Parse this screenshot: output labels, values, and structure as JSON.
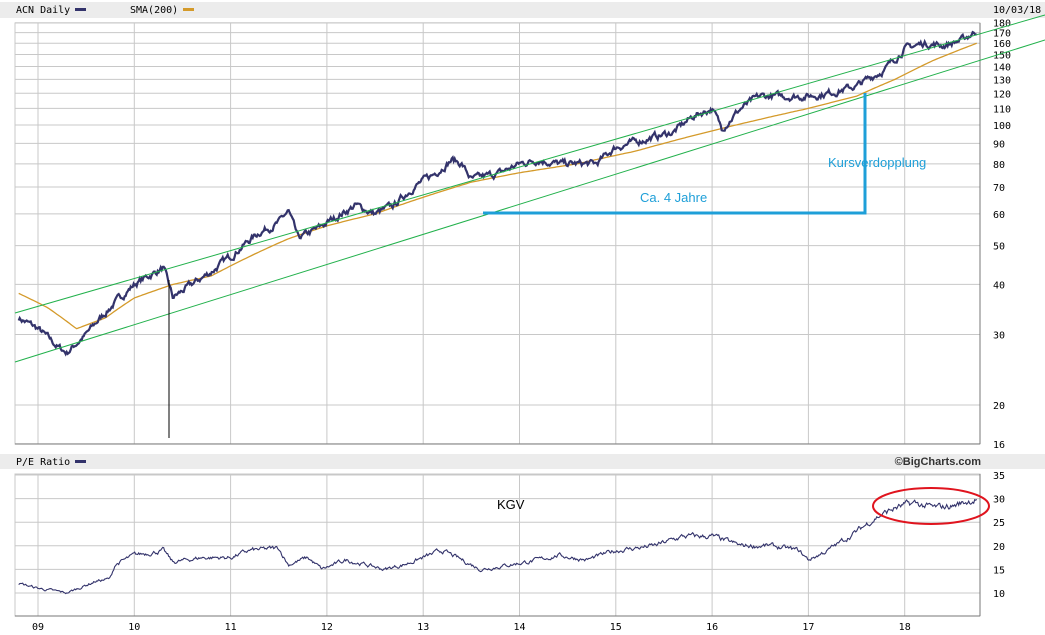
{
  "colors": {
    "price": "#33336b",
    "sma": "#d49a2a",
    "channel": "#22b14c",
    "annotation": "#1e9fd8",
    "highlight": "#e0141e",
    "grid": "#c8c8c8"
  },
  "chart_data": [
    {
      "type": "line",
      "title": "ACN Daily",
      "legend": [
        "ACN Daily",
        "SMA(200)"
      ],
      "date_label": "10/03/18",
      "yscale": "log",
      "ylim": [
        16,
        180
      ],
      "yticks": [
        180,
        170,
        160,
        150,
        140,
        130,
        120,
        110,
        100,
        90,
        80,
        70,
        60,
        50,
        40,
        30,
        20,
        16
      ],
      "xticks": [
        "09",
        "10",
        "11",
        "12",
        "13",
        "14",
        "15",
        "16",
        "17",
        "18"
      ],
      "series": [
        {
          "name": "ACN Daily",
          "x": [
            2008.8,
            2009.0,
            2009.2,
            2009.3,
            2009.5,
            2009.75,
            2010.0,
            2010.3,
            2010.4,
            2010.6,
            2010.8,
            2011.0,
            2011.3,
            2011.5,
            2011.6,
            2011.7,
            2011.9,
            2012.0,
            2012.3,
            2012.5,
            2012.7,
            2012.9,
            2013.1,
            2013.3,
            2013.4,
            2013.5,
            2013.8,
            2014.0,
            2014.2,
            2014.4,
            2014.6,
            2014.8,
            2015.0,
            2015.3,
            2015.6,
            2015.8,
            2016.0,
            2016.1,
            2016.3,
            2016.5,
            2016.8,
            2017.0,
            2017.2,
            2017.5,
            2017.8,
            2018.0,
            2018.2,
            2018.4,
            2018.6,
            2018.75
          ],
          "values": [
            33,
            31,
            28,
            27,
            30,
            35,
            40,
            44,
            37,
            40,
            43,
            47,
            54,
            57,
            61,
            52,
            55,
            57,
            63,
            60,
            63,
            70,
            75,
            82,
            80,
            73,
            76,
            80,
            82,
            80,
            80,
            80,
            88,
            92,
            96,
            105,
            110,
            98,
            110,
            118,
            118,
            118,
            120,
            125,
            138,
            155,
            160,
            158,
            163,
            172
          ]
        },
        {
          "name": "SMA(200)",
          "x": [
            2008.8,
            2009.1,
            2009.4,
            2009.7,
            2010.0,
            2010.4,
            2010.8,
            2011.2,
            2011.6,
            2012.0,
            2012.5,
            2013.0,
            2013.5,
            2014.0,
            2014.6,
            2015.2,
            2015.8,
            2016.4,
            2017.0,
            2017.5,
            2017.9,
            2018.3,
            2018.75
          ],
          "values": [
            38,
            35,
            31,
            33,
            37,
            40,
            42,
            47,
            52,
            56,
            60,
            66,
            72,
            76,
            80,
            86,
            94,
            102,
            110,
            118,
            130,
            145,
            160
          ]
        }
      ],
      "annotations": [
        "Kursverdopplung",
        "Ca. 4 Jahre"
      ]
    },
    {
      "type": "line",
      "title": "P/E Ratio",
      "ylim": [
        5,
        35
      ],
      "yticks": [
        35,
        30,
        25,
        20,
        15,
        10
      ],
      "xticks": [
        "09",
        "10",
        "11",
        "12",
        "13",
        "14",
        "15",
        "16",
        "17",
        "18"
      ],
      "series": [
        {
          "name": "P/E Ratio",
          "x": [
            2008.8,
            2009.0,
            2009.3,
            2009.6,
            2009.75,
            2009.8,
            2010.0,
            2010.3,
            2010.4,
            2010.7,
            2011.0,
            2011.2,
            2011.5,
            2011.6,
            2011.8,
            2011.95,
            2012.2,
            2012.4,
            2012.6,
            2012.8,
            2013.0,
            2013.2,
            2013.4,
            2013.6,
            2013.9,
            2014.2,
            2014.4,
            2014.7,
            2015.0,
            2015.4,
            2015.7,
            2016.0,
            2016.3,
            2016.6,
            2016.9,
            2017.0,
            2017.2,
            2017.5,
            2017.7,
            2017.9,
            2018.1,
            2018.3,
            2018.5,
            2018.75
          ],
          "values": [
            12,
            11,
            10,
            12.5,
            13,
            16,
            18,
            19,
            16.5,
            17.5,
            17.5,
            19,
            19.5,
            16,
            17.5,
            15,
            17,
            16,
            15,
            16,
            17.5,
            19,
            17,
            15,
            16,
            17,
            18,
            17,
            19,
            20,
            22,
            22,
            20,
            20,
            19,
            17,
            19,
            23,
            26,
            28,
            29,
            28,
            28.5,
            30
          ]
        }
      ],
      "annotations": [
        "KGV"
      ]
    }
  ],
  "credit": "©BigCharts.com"
}
